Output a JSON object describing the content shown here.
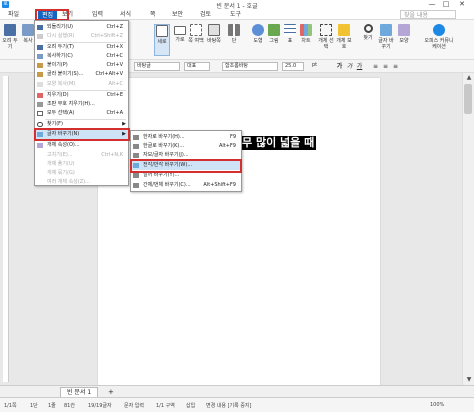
{
  "window": {
    "title": "빈 문서 1 - 호글",
    "app_icon": "호",
    "minimize": "—",
    "maximize": "□",
    "close": "✕"
  },
  "menubar": {
    "items": [
      "파일",
      "편집",
      "보기",
      "입력",
      "서식",
      "쪽",
      "보안",
      "검토",
      "도구"
    ],
    "search_placeholder": "찾을 내용"
  },
  "toolbar": {
    "buttons": [
      {
        "label": "오려\n두기",
        "icon": "scissors-icon"
      },
      {
        "label": "복사",
        "icon": "copy-icon"
      },
      {
        "label": "모양",
        "icon": "format-painter-icon"
      },
      {
        "label": "붙이",
        "icon": "paste-icon"
      },
      {
        "label": "세로",
        "icon": "portrait-page-icon"
      },
      {
        "label": "가로",
        "icon": "landscape-page-icon"
      },
      {
        "label": "쪽\n여백",
        "icon": "margins-icon"
      },
      {
        "label": "바탕쪽",
        "icon": "master-page-icon"
      },
      {
        "label": "단",
        "icon": "columns-icon"
      },
      {
        "label": "도형",
        "icon": "shape-icon"
      },
      {
        "label": "그림",
        "icon": "picture-icon"
      },
      {
        "label": "표",
        "icon": "table-icon"
      },
      {
        "label": "차트",
        "icon": "chart-icon"
      },
      {
        "label": "개체\n선택",
        "icon": "select-object-icon"
      },
      {
        "label": "개체\n보호",
        "icon": "protect-object-icon"
      },
      {
        "label": "찾기",
        "icon": "find-icon"
      },
      {
        "label": "글자\n바꾸기",
        "icon": "replace-icon"
      },
      {
        "label": "모양",
        "icon": "shape-style-icon"
      },
      {
        "label": "오피스\n커뮤니케이션",
        "icon": "office-community-icon"
      }
    ]
  },
  "formatbar": {
    "style": "바탕글",
    "font_category": "대표",
    "font": "함초롬바탕",
    "size": "25.0",
    "unit": "pt"
  },
  "document": {
    "text": "무 많이 넓을 때"
  },
  "edit_menu": {
    "items": [
      {
        "label": "되돌리기(U)",
        "shortcut": "Ctrl+Z",
        "disabled": false
      },
      {
        "label": "다시 실행(R)",
        "shortcut": "Ctrl+Shift+Z",
        "disabled": true
      },
      {
        "label": "오려 두기(T)",
        "shortcut": "Ctrl+X",
        "disabled": false
      },
      {
        "label": "복사하기(C)",
        "shortcut": "Ctrl+C",
        "disabled": false
      },
      {
        "label": "붙이기(P)",
        "shortcut": "Ctrl+V",
        "disabled": false
      },
      {
        "label": "골라 붙이기(S)...",
        "shortcut": "Ctrl+Alt+V",
        "disabled": false
      },
      {
        "label": "모양 복사(M)",
        "shortcut": "Alt+C",
        "disabled": true
      },
      {
        "label": "지우기(D)",
        "shortcut": "Ctrl+E",
        "disabled": false
      },
      {
        "label": "조판 부호 지우기(H)...",
        "shortcut": "",
        "disabled": false
      },
      {
        "label": "모두 선택(A)",
        "shortcut": "Ctrl+A",
        "disabled": false
      },
      {
        "label": "찾기(F)",
        "shortcut": "",
        "disabled": false
      },
      {
        "label": "글자 바꾸기(N)",
        "shortcut": "",
        "disabled": false
      },
      {
        "label": "개체 속성(O)...",
        "shortcut": "",
        "disabled": false
      },
      {
        "label": "고치기(E)...",
        "shortcut": "Ctrl+N,K",
        "disabled": true
      },
      {
        "label": "개체 풀기(U)",
        "shortcut": "",
        "disabled": true
      },
      {
        "label": "개체 묶기(G)",
        "shortcut": "",
        "disabled": true
      },
      {
        "label": "여러 개체 속성(Z)...",
        "shortcut": "",
        "disabled": true
      }
    ]
  },
  "submenu": {
    "items": [
      {
        "label": "한자로 바꾸기(H)...",
        "shortcut": "F9"
      },
      {
        "label": "한글로 바꾸기(K)...",
        "shortcut": "Alt+F9"
      },
      {
        "label": "자모/글자 바꾸기(J)...",
        "shortcut": ""
      },
      {
        "label": "전각/반각 바꾸기(W)...",
        "shortcut": ""
      },
      {
        "label": "일어 바꾸기(Y)...",
        "shortcut": ""
      },
      {
        "label": "간체/번체 바꾸기(C)...",
        "shortcut": "Alt+Shift+F9"
      }
    ]
  },
  "tabs": {
    "doc_tab": "빈 문서 1",
    "add": "+"
  },
  "status": {
    "items": [
      "1/1쪽",
      "1단",
      "1줄",
      "81칸",
      "19/19글자",
      "문자 입력",
      "1/1 구역",
      "삽입",
      "변경 내용 [기록 중지]"
    ],
    "zoom": "100%"
  },
  "colors": {
    "accent": "#1565c0",
    "highlight": "#d32f2f"
  }
}
